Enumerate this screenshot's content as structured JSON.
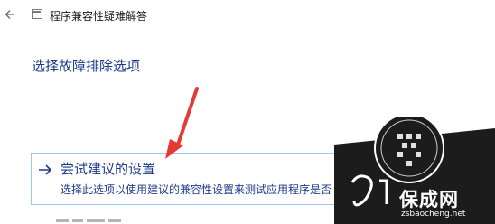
{
  "window": {
    "title": "程序兼容性疑难解答"
  },
  "page": {
    "heading": "选择故障排除选项"
  },
  "option": {
    "title": "尝试建议的设置",
    "description": "选择此选项以使用建议的兼容性设置来测试应用程序是否"
  },
  "icons": {
    "back": "back-arrow-icon",
    "app": "window-icon",
    "option": "right-arrow-icon"
  },
  "watermark": {
    "brand": "保成网",
    "url": "zsbaocheng.net"
  },
  "colors": {
    "accent": "#1f3a8a",
    "card_border": "#9ec8ea",
    "annotation": "#e53935",
    "watermark_bg": "#1c1c1c"
  }
}
